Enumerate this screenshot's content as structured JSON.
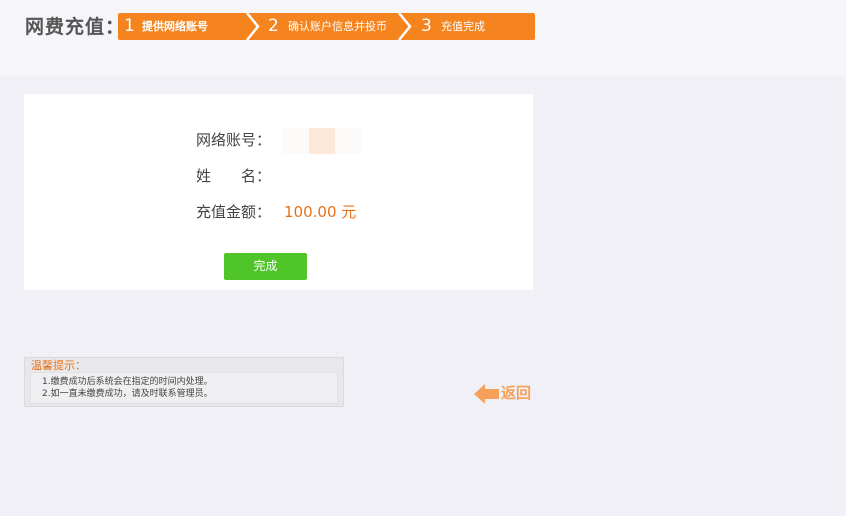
{
  "header": {
    "title": "网费充值："
  },
  "steps": [
    {
      "number": "1",
      "label": "提供网络账号"
    },
    {
      "number": "2",
      "label": "确认账户信息并投币"
    },
    {
      "number": "3",
      "label": "充值完成"
    }
  ],
  "colors": {
    "accent": "#f5841f",
    "amount": "#e8711c",
    "button": "#4fc52a"
  },
  "form": {
    "account_label": "网络账号：",
    "name_label": "姓　　名：",
    "amount_label": "充值金额：",
    "amount_value": "100.00 元",
    "done_button": "完成"
  },
  "tips": {
    "title": "温馨提示：",
    "lines": [
      "1.缴费成功后系统会在指定的时间内处理。",
      "2.如一直未缴费成功，请及时联系管理员。"
    ]
  },
  "back": {
    "label": "返回",
    "icon": "arrow-left-icon"
  }
}
